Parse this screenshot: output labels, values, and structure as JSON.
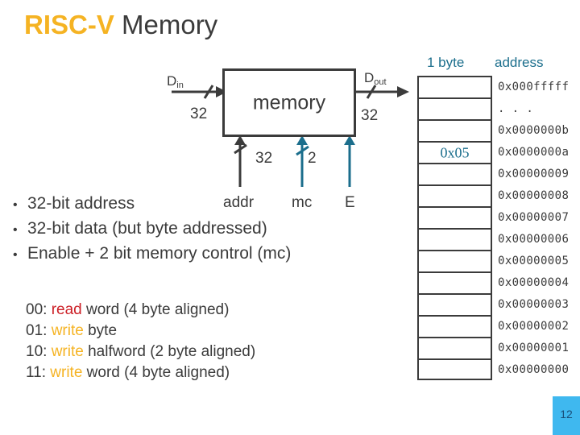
{
  "slide": {
    "title_accent": "RISC-V",
    "title_rest": " Memory",
    "accent_color": "#f5b323",
    "text_color": "#3b3b3b",
    "page_number": "12",
    "badge_color": "#3fb8ef"
  },
  "diagram": {
    "block_label": "memory",
    "din_label": "D",
    "din_sub": "in",
    "dout_label": "D",
    "dout_sub": "out",
    "din_width": "32",
    "dout_width": "32",
    "addr_width": "32",
    "mc_width": "2",
    "addr_port": "addr",
    "mc_port": "mc",
    "enable_port": "E",
    "control_color": "#1b6e8c"
  },
  "bullets": {
    "marker": "•",
    "items": [
      "32-bit address",
      "32-bit data (but byte addressed)",
      "Enable + 2 bit memory control (mc)"
    ]
  },
  "encodings": [
    {
      "code": "00: ",
      "op": "read",
      "op_kind": "read",
      "rest": " word (4 byte aligned)"
    },
    {
      "code": "01: ",
      "op": "write",
      "op_kind": "write",
      "rest": " byte"
    },
    {
      "code": "10: ",
      "op": "write",
      "op_kind": "write",
      "rest": " halfword  (2 byte aligned)"
    },
    {
      "code": "11: ",
      "op": "write",
      "op_kind": "write",
      "rest": " word (4 byte aligned)"
    }
  ],
  "encoding_colors": {
    "read": "#cc2027",
    "write": "#f5b323"
  },
  "memory_table": {
    "header_byte": "1 byte",
    "header_address": "address",
    "header_color": "#1b6e8c",
    "rows": [
      {
        "value": "",
        "address": "0x000fffff"
      },
      {
        "value": "",
        "address": ".  .  ."
      },
      {
        "value": "",
        "address": "0x0000000b"
      },
      {
        "value": "0x05",
        "address": "0x0000000a"
      },
      {
        "value": "",
        "address": "0x00000009"
      },
      {
        "value": "",
        "address": "0x00000008"
      },
      {
        "value": "",
        "address": "0x00000007"
      },
      {
        "value": "",
        "address": "0x00000006"
      },
      {
        "value": "",
        "address": "0x00000005"
      },
      {
        "value": "",
        "address": "0x00000004"
      },
      {
        "value": "",
        "address": "0x00000003"
      },
      {
        "value": "",
        "address": "0x00000002"
      },
      {
        "value": "",
        "address": "0x00000001"
      },
      {
        "value": "",
        "address": "0x00000000"
      }
    ]
  }
}
